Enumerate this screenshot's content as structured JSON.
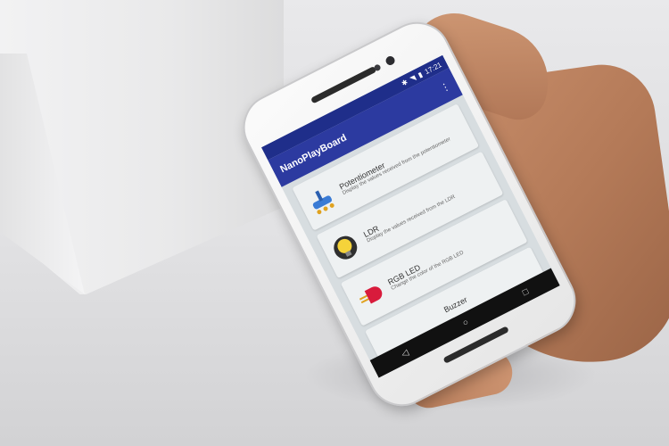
{
  "app": {
    "title": "NanoPlayBoard",
    "status_time": "17:21",
    "menu_icon": "more-vert-icon"
  },
  "cards": [
    {
      "title": "Potentiometer",
      "description": "Display the values received from the potentiometer",
      "icon": "potentiometer-icon"
    },
    {
      "title": "LDR",
      "description": "Display the values received from the LDR",
      "icon": "lightbulb-icon"
    },
    {
      "title": "RGB LED",
      "description": "Change the color of the RGB LED",
      "icon": "led-icon"
    },
    {
      "title": "Buzzer",
      "icon": "buzzer-icon"
    }
  ],
  "navbar": {
    "back": "◁",
    "home": "○",
    "recents": "□"
  },
  "colors": {
    "appbar": "#2c3aa0",
    "statusbar": "#1f2e8a",
    "screen_bg": "#d7dde0"
  }
}
